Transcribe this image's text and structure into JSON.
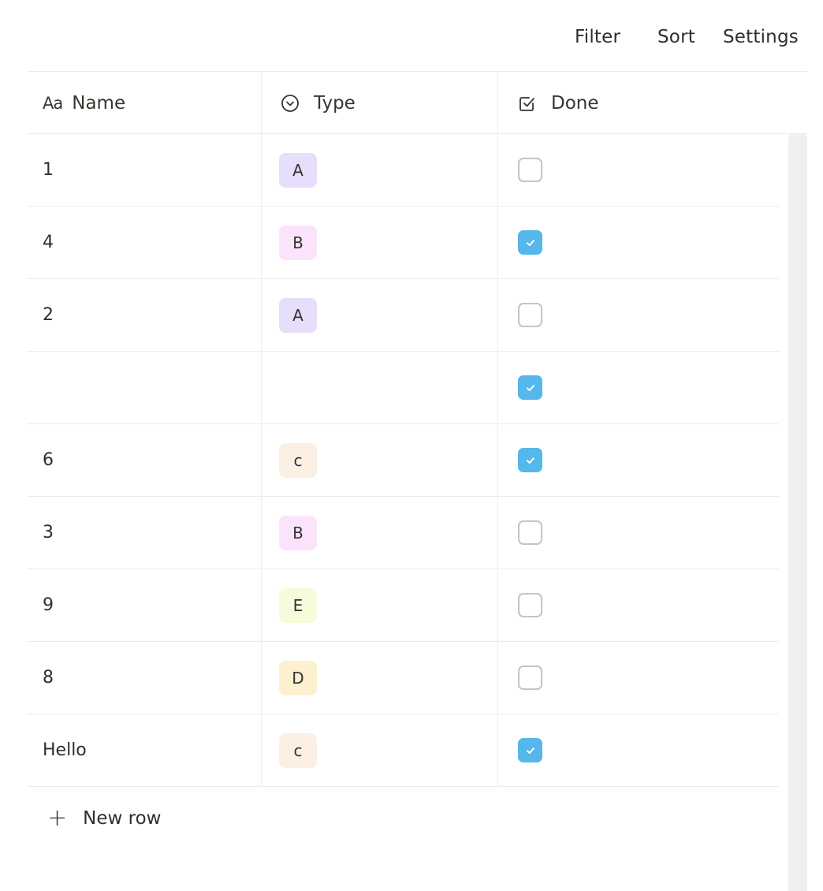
{
  "toolbar": {
    "filter_label": "Filter",
    "sort_label": "Sort",
    "settings_label": "Settings"
  },
  "columns": {
    "name": {
      "label": "Name",
      "icon": "text-type-icon",
      "icon_glyph": "Aa"
    },
    "type": {
      "label": "Type",
      "icon": "select-icon"
    },
    "done": {
      "label": "Done",
      "icon": "checkbox-icon"
    }
  },
  "rows": [
    {
      "name": "1",
      "type": "A",
      "type_color": "#e6defa",
      "done": false
    },
    {
      "name": "4",
      "type": "B",
      "type_color": "#fbe4fb",
      "done": true
    },
    {
      "name": "2",
      "type": "A",
      "type_color": "#e6defa",
      "done": false
    },
    {
      "name": "",
      "type": "",
      "type_color": "",
      "done": true
    },
    {
      "name": "6",
      "type": "c",
      "type_color": "#fcefe4",
      "done": true
    },
    {
      "name": "3",
      "type": "B",
      "type_color": "#fbe4fb",
      "done": false
    },
    {
      "name": "9",
      "type": "E",
      "type_color": "#f5fbdb",
      "done": false
    },
    {
      "name": "8",
      "type": "D",
      "type_color": "#fdf0cf",
      "done": false
    },
    {
      "name": "Hello",
      "type": "c",
      "type_color": "#fcefe4",
      "done": true
    }
  ],
  "new_row_label": "New row",
  "colors": {
    "checkbox_checked": "#55b7ea",
    "checkbox_border": "#c4c4c4",
    "divider": "#ececec"
  }
}
